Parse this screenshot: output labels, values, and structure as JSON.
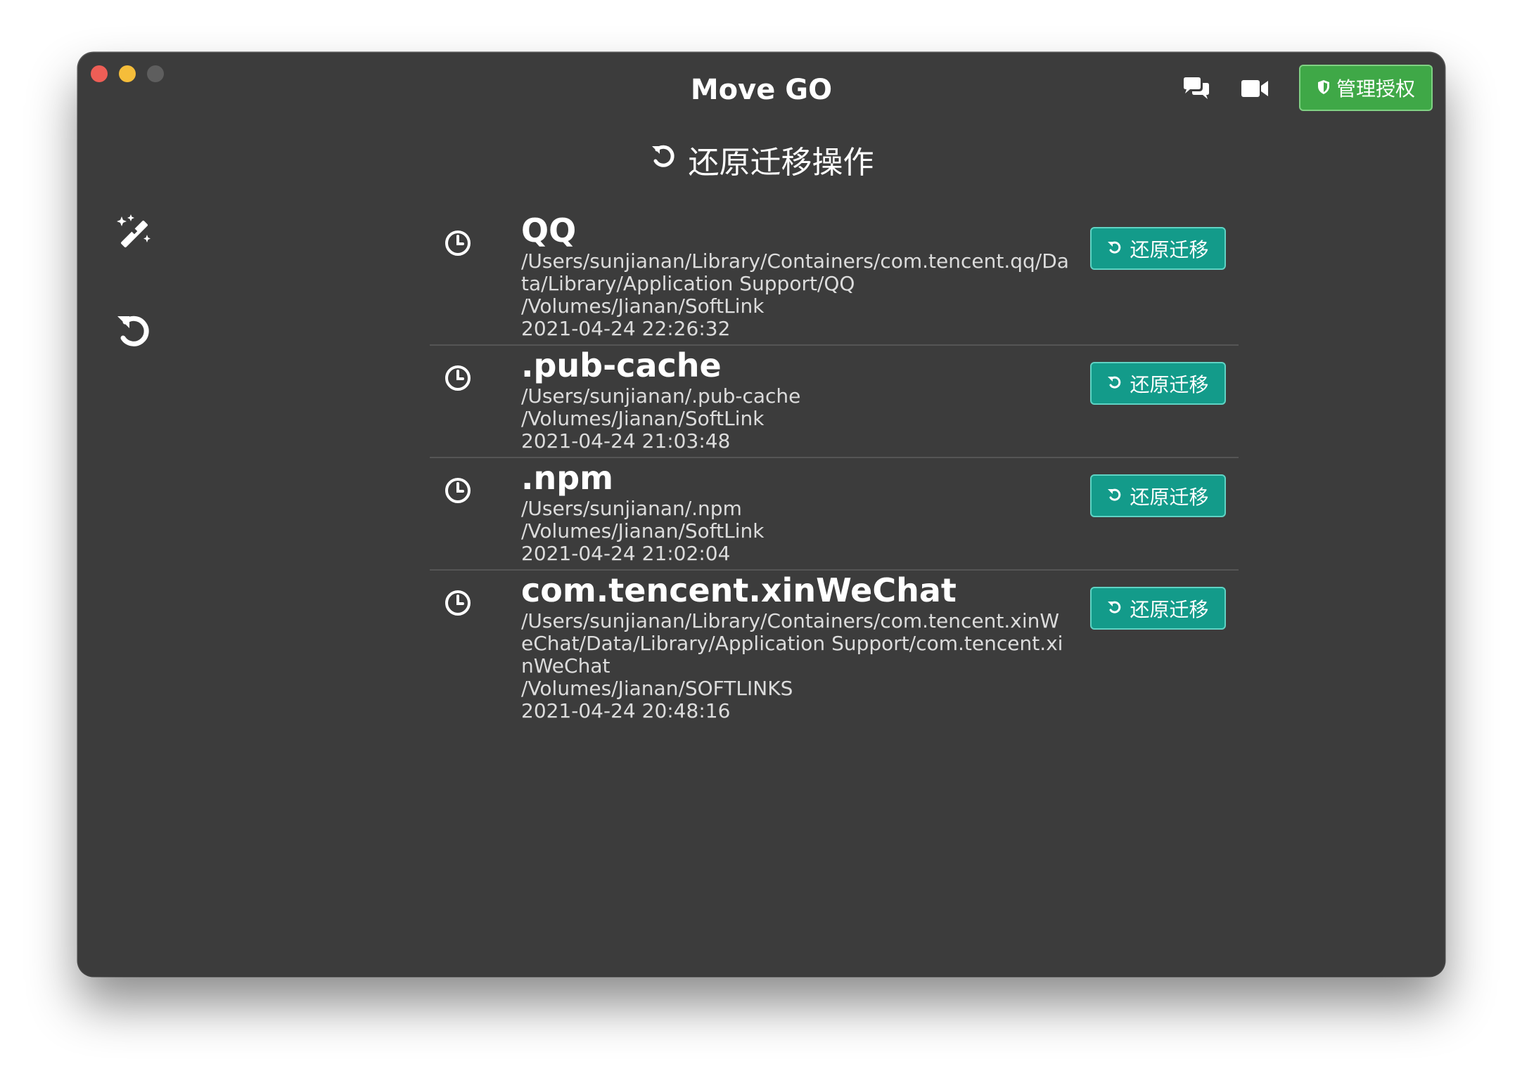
{
  "window": {
    "title": "Move GO"
  },
  "header": {
    "license_button_label": "管理授权",
    "icons": [
      "chat-icon",
      "video-icon",
      "shield-icon"
    ]
  },
  "section": {
    "title": "还原迁移操作",
    "icon": "undo-icon"
  },
  "sidebar": {
    "items": [
      {
        "icon": "magic-wand-icon"
      },
      {
        "icon": "undo-icon"
      }
    ]
  },
  "records": [
    {
      "name": "QQ",
      "source": "/Users/sunjianan/Library/Containers/com.tencent.qq/Data/Library/Application Support/QQ",
      "target": "/Volumes/Jianan/SoftLink",
      "time": "2021-04-24 22:26:32",
      "button_label": "还原迁移"
    },
    {
      "name": ".pub-cache",
      "source": "/Users/sunjianan/.pub-cache",
      "target": "/Volumes/Jianan/SoftLink",
      "time": "2021-04-24 21:03:48",
      "button_label": "还原迁移"
    },
    {
      "name": ".npm",
      "source": "/Users/sunjianan/.npm",
      "target": "/Volumes/Jianan/SoftLink",
      "time": "2021-04-24 21:02:04",
      "button_label": "还原迁移"
    },
    {
      "name": "com.tencent.xinWeChat",
      "source": "/Users/sunjianan/Library/Containers/com.tencent.xinWeChat/Data/Library/Application Support/com.tencent.xinWeChat",
      "target": "/Volumes/Jianan/SOFTLINKS",
      "time": "2021-04-24 20:48:16",
      "button_label": "还原迁移"
    }
  ],
  "colors": {
    "window_bg": "#3c3c3c",
    "license_button": "#3fa847",
    "restore_button": "#139b8a"
  }
}
